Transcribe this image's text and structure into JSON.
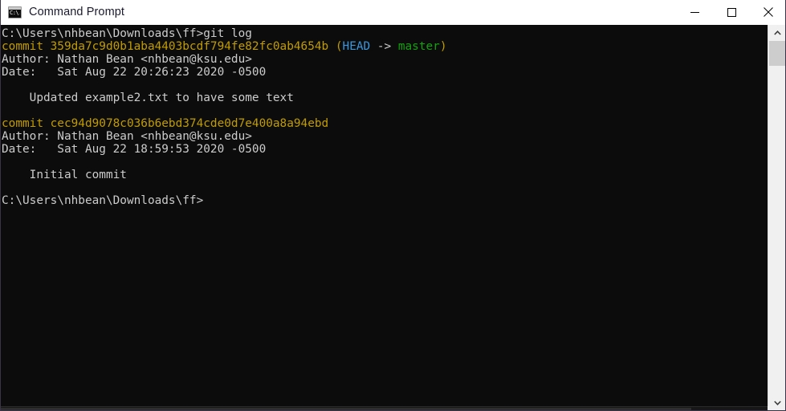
{
  "window": {
    "title": "Command Prompt",
    "icon": "command-prompt-icon",
    "icon_glyph": "C:\\.",
    "controls": {
      "minimize": "Minimize",
      "maximize": "Maximize",
      "close": "Close"
    }
  },
  "colors": {
    "terminal_background": "#0c0c0c",
    "default_text": "#cccccc",
    "commit_hash": "#c19c00",
    "head_pointer": "#3a96dd",
    "branch_name": "#13a10e",
    "titlebar_background": "#ffffff",
    "titlebar_text": "#1a1a2e",
    "window_border": "#3b3348",
    "scrollbar_track": "#f0f0f0",
    "scrollbar_thumb": "#cdcdcd"
  },
  "terminal": {
    "prompt_path": "C:\\Users\\nhbean\\Downloads\\ff>",
    "command": "git log",
    "lines": [
      {
        "id": "prompt-command-line",
        "segments": [
          {
            "text": "C:\\Users\\nhbean\\Downloads\\ff>git log",
            "color": "default"
          }
        ]
      },
      {
        "id": "commit-1-hash-line",
        "segments": [
          {
            "text": "commit 359da7c9d0b1aba4403bcdf794fe82fc0ab4654b ",
            "color": "hash"
          },
          {
            "text": "(",
            "color": "paren"
          },
          {
            "text": "HEAD",
            "color": "head"
          },
          {
            "text": " -> ",
            "color": "arrow"
          },
          {
            "text": "master",
            "color": "branch"
          },
          {
            "text": ")",
            "color": "paren"
          }
        ]
      },
      {
        "id": "commit-1-author-line",
        "segments": [
          {
            "text": "Author: Nathan Bean <nhbean@ksu.edu>",
            "color": "default"
          }
        ]
      },
      {
        "id": "commit-1-date-line",
        "segments": [
          {
            "text": "Date:   Sat Aug 22 20:26:23 2020 -0500",
            "color": "default"
          }
        ]
      },
      {
        "id": "blank-line-1",
        "segments": [
          {
            "text": "",
            "color": "default"
          }
        ]
      },
      {
        "id": "commit-1-message-line",
        "segments": [
          {
            "text": "    Updated example2.txt to have some text",
            "color": "default"
          }
        ]
      },
      {
        "id": "blank-line-2",
        "segments": [
          {
            "text": "",
            "color": "default"
          }
        ]
      },
      {
        "id": "commit-2-hash-line",
        "segments": [
          {
            "text": "commit cec94d9078c036b6ebd374cde0d7e400a8a94ebd",
            "color": "hash"
          }
        ]
      },
      {
        "id": "commit-2-author-line",
        "segments": [
          {
            "text": "Author: Nathan Bean <nhbean@ksu.edu>",
            "color": "default"
          }
        ]
      },
      {
        "id": "commit-2-date-line",
        "segments": [
          {
            "text": "Date:   Sat Aug 22 18:59:53 2020 -0500",
            "color": "default"
          }
        ]
      },
      {
        "id": "blank-line-3",
        "segments": [
          {
            "text": "",
            "color": "default"
          }
        ]
      },
      {
        "id": "commit-2-message-line",
        "segments": [
          {
            "text": "    Initial commit",
            "color": "default"
          }
        ]
      },
      {
        "id": "blank-line-4",
        "segments": [
          {
            "text": "",
            "color": "default"
          }
        ]
      },
      {
        "id": "final-prompt-line",
        "segments": [
          {
            "text": "C:\\Users\\nhbean\\Downloads\\ff>",
            "color": "default"
          }
        ]
      }
    ],
    "commits": [
      {
        "hash": "359da7c9d0b1aba4403bcdf794fe82fc0ab4654b",
        "refs": "(HEAD -> master)",
        "head": "HEAD",
        "arrow": "->",
        "branch": "master",
        "author_name": "Nathan Bean",
        "author_email": "nhbean@ksu.edu",
        "author_line": "Author: Nathan Bean <nhbean@ksu.edu>",
        "date": "Sat Aug 22 20:26:23 2020 -0500",
        "message": "Updated example2.txt to have some text"
      },
      {
        "hash": "cec94d9078c036b6ebd374cde0d7e400a8a94ebd",
        "refs": "",
        "author_name": "Nathan Bean",
        "author_email": "nhbean@ksu.edu",
        "author_line": "Author: Nathan Bean <nhbean@ksu.edu>",
        "date": "Sat Aug 22 18:59:53 2020 -0500",
        "message": "Initial commit"
      }
    ]
  },
  "scrollbars": {
    "vertical": {
      "up_arrow": "scroll-up",
      "down_arrow": "scroll-down",
      "thumb": "vertical-scroll-thumb"
    },
    "horizontal": {
      "thumb": "horizontal-scroll-thumb"
    }
  }
}
